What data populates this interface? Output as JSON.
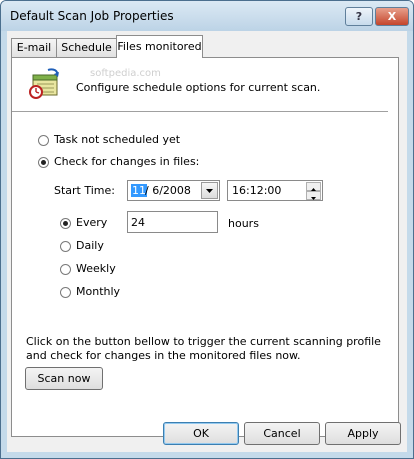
{
  "window": {
    "title": "Default Scan Job Properties",
    "help_label": "?",
    "close_label": "X"
  },
  "tabs": [
    {
      "label": "E-mail",
      "active": false
    },
    {
      "label": "Schedule",
      "active": false
    },
    {
      "label": "Files monitored",
      "active": true
    }
  ],
  "header": {
    "description": "Configure schedule options for current scan.",
    "icon": "schedule-calendar-icon",
    "watermark": "softpedia.com"
  },
  "schedule": {
    "option_not_scheduled": "Task not scheduled yet",
    "option_check_changes": "Check for changes in files:",
    "selected": "check",
    "start_time_label": "Start Time:",
    "date_month": "11",
    "date_rest": "/  6/2008",
    "time_value": "16:12:00"
  },
  "frequency": {
    "every_label": "Every",
    "every_value": "24",
    "every_unit": "hours",
    "daily_label": "Daily",
    "weekly_label": "Weekly",
    "monthly_label": "Monthly",
    "selected": "every"
  },
  "scan": {
    "description": "Click on the button bellow to trigger the current scanning profile and check for changes in the monitored files now.",
    "button_label": "Scan now"
  },
  "footer": {
    "ok_label": "OK",
    "cancel_label": "Cancel",
    "apply_label": "Apply"
  },
  "colors": {
    "title_bar": "#c4daea",
    "close_button": "#c4452c",
    "selection": "#3399ff"
  }
}
